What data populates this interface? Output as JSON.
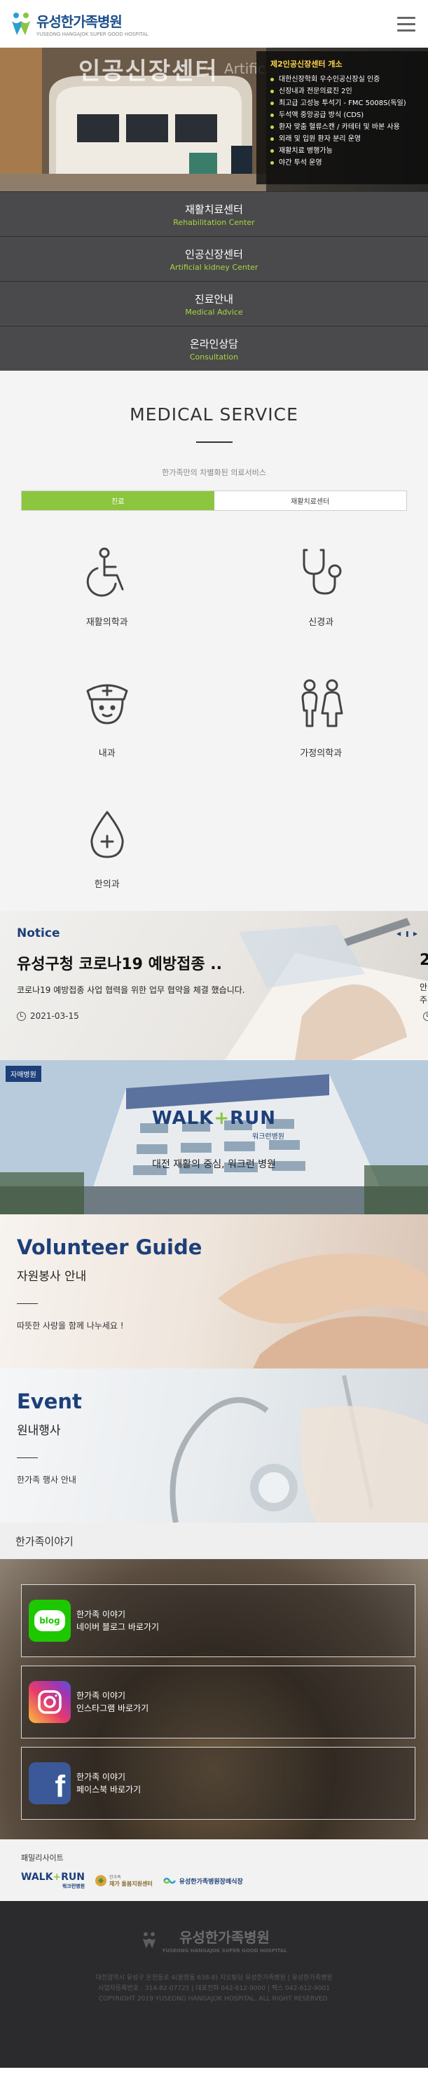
{
  "header": {
    "logo_name": "유성한가족병원",
    "logo_sub": "YUSEONG HANGAJOK SUPER GOOD HOSPITAL"
  },
  "hero": {
    "title": "인공신장센터",
    "title_en": "Artific",
    "box_title": "제2인공신장센터 개소",
    "items": [
      "대한신장학회 우수인공신장실 인증",
      "신장내과 전문의료진 2인",
      "최고급 고성능 투석기 - FMC 5008S(독일)",
      "두석액 중앙공급 방식 (CDS)",
      "환자 맞춤 혈류스캔 / 카테터 및 바본 사용",
      "외래 및 입원 환자 분리 운영",
      "재활치료 병행가능",
      "야간 투석 운영"
    ]
  },
  "dark_menu": [
    {
      "ko": "재활치료센터",
      "en": "Rehabilitation Center"
    },
    {
      "ko": "인공신장센터",
      "en": "Artificial kidney Center"
    },
    {
      "ko": "진료안내",
      "en": "Medical Advice"
    },
    {
      "ko": "온라인상담",
      "en": "Consultation"
    }
  ],
  "medical": {
    "title": "MEDICAL SERVICE",
    "subtitle": "한가족만의 차별화된 의료서비스",
    "tabs": [
      "진료",
      "재활치료센터"
    ],
    "items": [
      {
        "label": "재활의학과",
        "icon": "wheelchair-icon"
      },
      {
        "label": "신경과",
        "icon": "stethoscope-icon"
      },
      {
        "label": "내과",
        "icon": "nurse-icon"
      },
      {
        "label": "가정의학과",
        "icon": "family-icon"
      },
      {
        "label": "한의과",
        "icon": "medicine-drop-icon"
      }
    ]
  },
  "notice": {
    "label": "Notice",
    "title": "유성구청 코로나19 예방접종 ..",
    "desc": "코로나19 예방접종 사업 협력을 위한 업무 협약을 체결 했습니다.",
    "date": "2021-03-15",
    "peek_title": "2",
    "peek_desc_1": "안",
    "peek_desc_2": "주"
  },
  "walkrun": {
    "badge": "자매병원",
    "logo_a": "WALK",
    "logo_plus": "+",
    "logo_b": "RUN",
    "logo_sub": "워크런병원",
    "desc": "대전 재활의 중심, 워크런 병원"
  },
  "volunteer": {
    "title": "Volunteer Guide",
    "subtitle": "자원봉사 안내",
    "desc": "따뜻한 사랑을 함께 나누세요 !"
  },
  "event": {
    "title": "Event",
    "subtitle": "원내행사",
    "desc": "한가족 행사 안내"
  },
  "story": {
    "heading": "한가족이야기",
    "cards": [
      {
        "icon": "blog-icon",
        "badge": "blog",
        "line1": "한가족 이야기",
        "line2": "네이버 블로그 바로가기"
      },
      {
        "icon": "instagram-icon",
        "badge": "",
        "line1": "한가족 이야기",
        "line2": "인스타그램 바로가기"
      },
      {
        "icon": "facebook-icon",
        "badge": "f",
        "line1": "한가족 이야기",
        "line2": "페이스북 바로가기"
      }
    ]
  },
  "family": {
    "title": "패밀리사이트",
    "walk_a": "WALK",
    "walk_plus": "+",
    "walk_b": "RUN",
    "walk_sub": "워크런병원",
    "center_top": "한가족",
    "center_main": "재가 돌봄지원센터",
    "shop": "유성한가족병원장례식장"
  },
  "footer": {
    "logo": "유성한가족병원",
    "logo_sub": "YUSEONG HANGAJOK SUPER GOOD HOSPITAL",
    "line1": "대전광역시 유성구 온천동로 4(봉명동 638-8) 지오빌딩 유성한가족병원 | 유성한가족병원",
    "line2": "사업자등록번호 : 314-82-07725 | 대표전화 042-612-9000 | 팩스 042-612-9001",
    "line3": "COPYRIGHT 2019 YUSEONG HANGAJOK HOSPITAL. ALL RIGHT RESERVED."
  },
  "colors": {
    "accent_green": "#8cc63f",
    "navy": "#1d3f7a",
    "menu_dark": "#4a4a4c"
  }
}
